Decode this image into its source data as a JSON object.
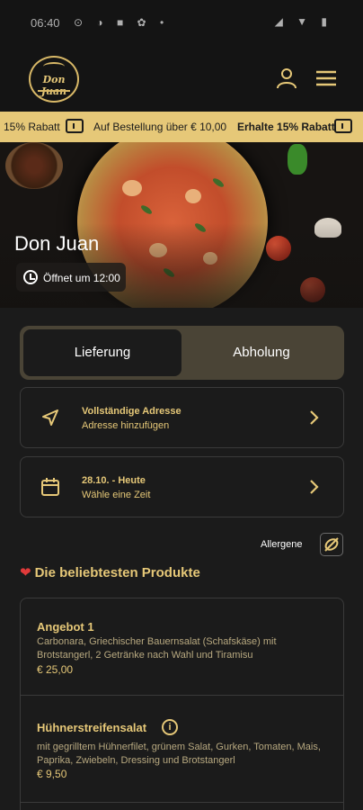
{
  "status_bar": {
    "time": "06:40",
    "left_icons": "⊙ ◑ ■ ✿ •",
    "right_icons": "◢ ▼ ▮"
  },
  "header": {
    "logo_text": "Don Juan"
  },
  "ticker": {
    "items": [
      "15% Rabatt",
      "Auf Bestellung über € 10,00",
      "Erhalte 15% Rabatt"
    ]
  },
  "hero": {
    "restaurant_name": "Don Juan",
    "opening": "Öffnet um 12:00"
  },
  "order_mode": {
    "delivery": "Lieferung",
    "pickup": "Abholung"
  },
  "address": {
    "title": "Vollständige Adresse",
    "subtitle": "Adresse hinzufügen"
  },
  "time_slot": {
    "title": "28.10. - Heute",
    "subtitle": "Wähle eine Zeit"
  },
  "allergens": {
    "label": "Allergene"
  },
  "popular": {
    "title": "Die beliebtesten Produkte",
    "products": [
      {
        "name": "Angebot 1",
        "description": "Carbonara, Griechischer Bauernsalat (Schafskäse) mit Brotstangerl, 2 Getränke nach Wahl und Tiramisu",
        "price": "€ 25,00"
      },
      {
        "name": "Hühnerstreifensalat",
        "description": "mit gegrilltem Hühnerfilet, grünem Salat, Gurken, Tomaten, Mais, Paprika, Zwiebeln, Dressing und Brotstangerl",
        "price": "€ 9,50"
      }
    ]
  },
  "colors": {
    "gold": "#e6c878",
    "background": "#1b1b1b",
    "ticker": "#e6c878",
    "heart": "#e03a3a"
  }
}
